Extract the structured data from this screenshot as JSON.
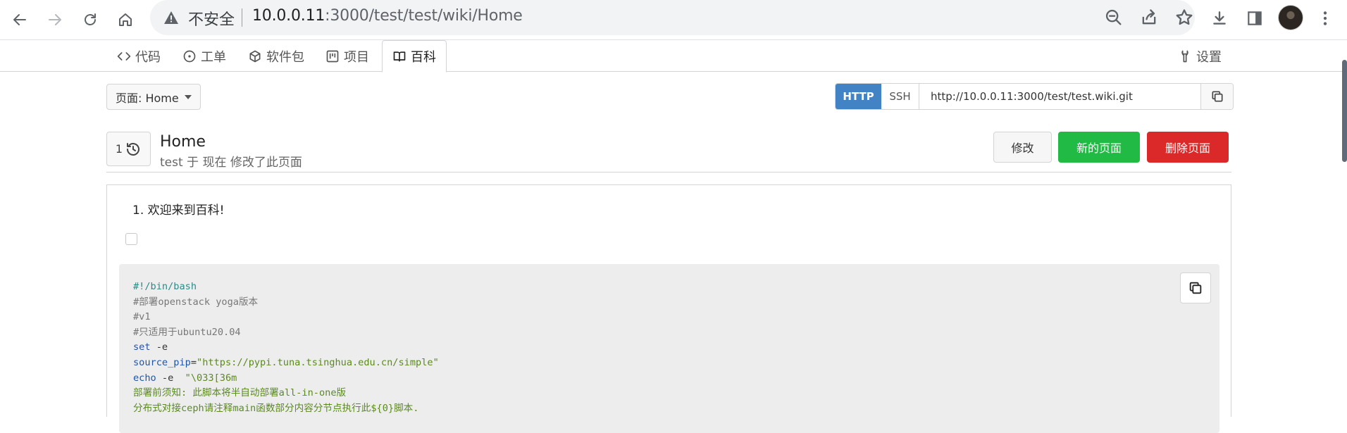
{
  "browser": {
    "insecure_label": "不安全",
    "url_host": "10.0.0.11",
    "url_path": ":3000/test/test/wiki/Home"
  },
  "repo_tabs": {
    "code": "代码",
    "issues": "工单",
    "packages": "软件包",
    "projects": "项目",
    "wiki": "百科",
    "settings": "设置"
  },
  "header": {
    "page_dropdown": "页面: Home",
    "clone_http": "HTTP",
    "clone_ssh": "SSH",
    "clone_url": "http://10.0.0.11:3000/test/test.wiki.git",
    "history_count": "1",
    "title": "Home",
    "subtitle": "test 于 现在 修改了此页面",
    "edit_label": "修改",
    "new_page_label": "新的页面",
    "delete_page_label": "删除页面"
  },
  "content": {
    "list_item": "1. 欢迎来到百科!",
    "code_lines": [
      {
        "text": "#!/bin/bash",
        "kind": "shebang"
      },
      {
        "text": "#部署openstack yoga版本",
        "kind": "comment"
      },
      {
        "text": "#v1",
        "kind": "comment"
      },
      {
        "text": "#只适用于ubuntu20.04",
        "kind": "comment"
      },
      {
        "text": "set -e",
        "kind": "kw"
      },
      {
        "text": "source_pip=\"https://pypi.tuna.tsinghua.edu.cn/simple\"",
        "kind": "assign"
      },
      {
        "text": "echo -e  \"\\033[36m",
        "kind": "echo"
      },
      {
        "text": "部署前须知: 此脚本将半自动部署all-in-one版",
        "kind": "str"
      },
      {
        "text": "分布式对接ceph请注释main函数部分内容分节点执行此${0}脚本.",
        "kind": "str"
      }
    ]
  },
  "colors": {
    "accent_blue": "#4183c4",
    "green": "#21ba45",
    "red": "#db2828"
  }
}
